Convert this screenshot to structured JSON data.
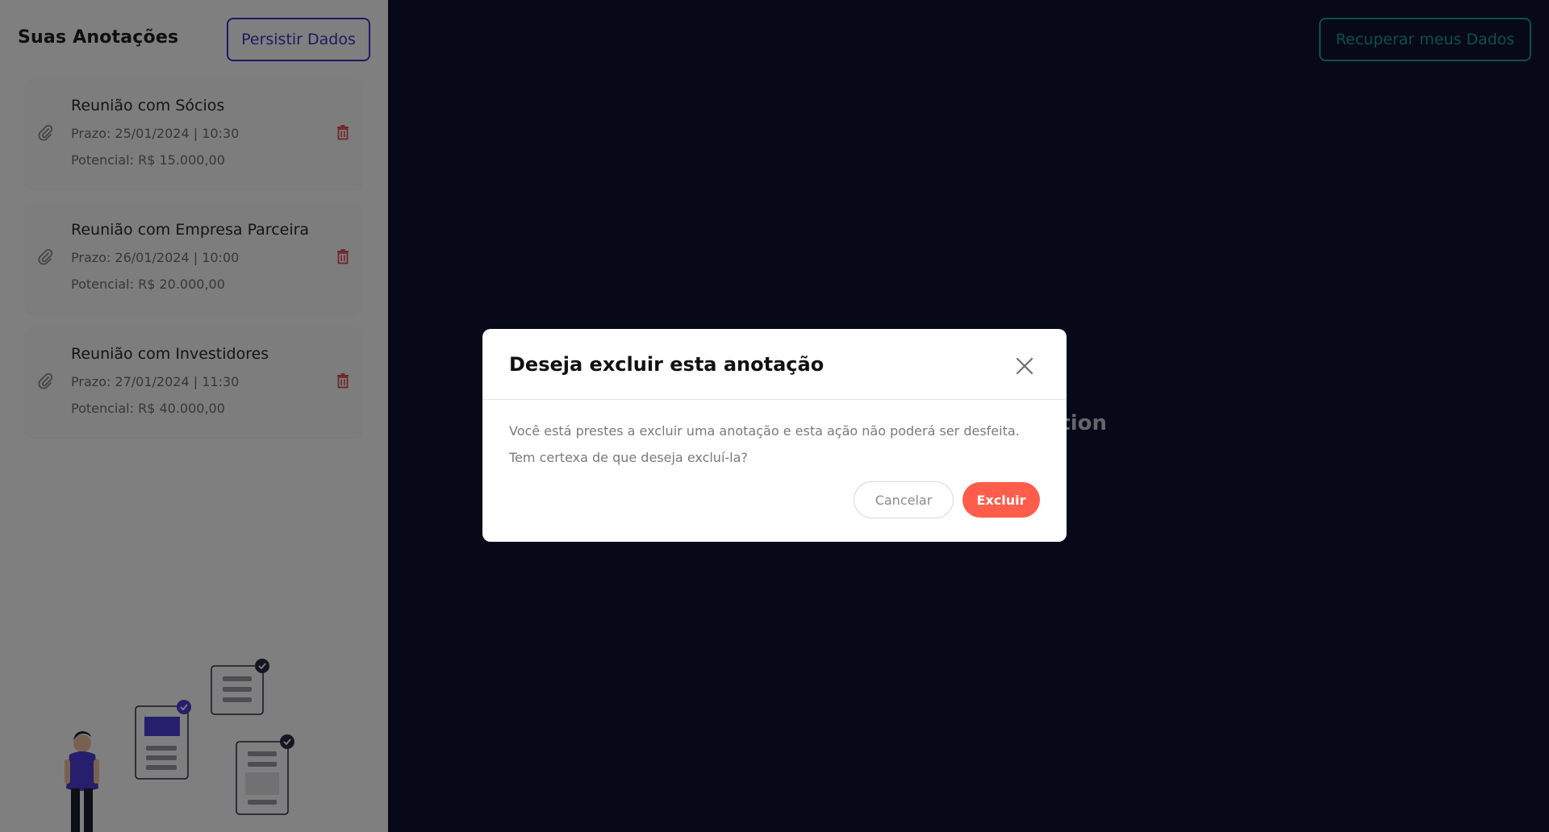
{
  "sidebar": {
    "title": "Suas Anotações",
    "persist_button": "Persistir Dados",
    "notes": [
      {
        "title": "Reunião com Sócios",
        "deadline": "Prazo: 25/01/2024 | 10:30",
        "potential": "Potencial: R$ 15.000,00"
      },
      {
        "title": "Reunião com Empresa Parceira",
        "deadline": "Prazo: 26/01/2024 | 10:00",
        "potential": "Potencial: R$ 20.000,00"
      },
      {
        "title": "Reunião com Investidores",
        "deadline": "Prazo: 27/01/2024 | 11:30",
        "potential": "Potencial: R$ 40.000,00"
      }
    ]
  },
  "main": {
    "recover_button": "Recuperar meus Dados",
    "visible_text_fragment": "tion"
  },
  "modal": {
    "title": "Deseja excluir esta anotação",
    "body_line_1": "Você está prestes a excluir uma anotação e esta ação não poderá ser desfeita.",
    "body_line_2": "Tem certexa de que deseja excluí-la?",
    "cancel_button": "Cancelar",
    "delete_button": "Excluir"
  },
  "colors": {
    "main_background": "#0f1130",
    "persist_accent": "#3b33c9",
    "recover_accent": "#12a58b",
    "delete_button": "#ff5d4b",
    "trash_icon": "#e34a5a"
  },
  "icons": {
    "note_attachment": "paperclip-icon",
    "note_delete": "trash-icon",
    "modal_close": "close-icon"
  }
}
